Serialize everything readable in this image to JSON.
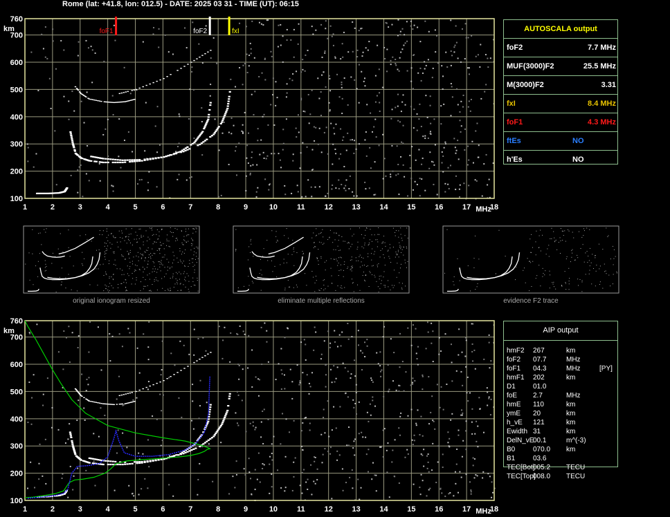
{
  "header": "Rome (lat: +41.8, lon: 012.5) - DATE: 2025 03 31 - TIME (UT): 06:15",
  "colors": {
    "grid": "#9a9a80",
    "frame": "#e6e6a0",
    "fof1": "#ff1a1a",
    "fxi": "#ffff00",
    "ftes": "#2a7fff",
    "profile": "#00d000",
    "aip_trace": "#2a2aff"
  },
  "autoscala": {
    "title": "AUTOSCALA output",
    "rows": [
      {
        "key": "foF2",
        "value": "7.7 MHz",
        "color": "#ffffff"
      },
      {
        "key": "MUF(3000)F2",
        "value": "25.5 MHz",
        "color": "#ffffff"
      },
      {
        "key": "M(3000)F2",
        "value": "3.31",
        "color": "#ffffff"
      },
      {
        "key": "fxI",
        "value": "8.4 MHz",
        "color": "#e6c200"
      },
      {
        "key": "foF1",
        "value": "4.3 MHz",
        "color": "#ff1a1a"
      },
      {
        "key": "ftEs",
        "value": "NO",
        "color": "#2a7fff"
      },
      {
        "key": "h'Es",
        "value": "NO",
        "color": "#ffffff"
      }
    ]
  },
  "aip": {
    "title": "AIP output",
    "rows": [
      [
        "hmF2",
        "267",
        "km",
        ""
      ],
      [
        "foF2",
        "07.7",
        "MHz",
        ""
      ],
      [
        "foF1",
        "04.3",
        "MHz",
        "[PY]"
      ],
      [
        "hmF1",
        "202",
        "km",
        ""
      ],
      [
        "D1",
        "01.0",
        "",
        ""
      ],
      [
        "foE",
        "2.7",
        "MHz",
        ""
      ],
      [
        "hmE",
        "110",
        "km",
        ""
      ],
      [
        "ymE",
        "20",
        "km",
        ""
      ],
      [
        "h_vE",
        "121",
        "km",
        ""
      ],
      [
        "Ewidth",
        "31",
        "km",
        ""
      ],
      [
        "DelN_vE",
        "00.1",
        "m^(-3)",
        ""
      ],
      [
        "B0",
        "070.0",
        "km",
        ""
      ],
      [
        "B1",
        "03.6",
        "",
        ""
      ],
      [
        "TEC[Bot]",
        "005.2",
        "TECU",
        ""
      ],
      [
        "TEC[Top]",
        "008.0",
        "TECU",
        ""
      ]
    ]
  },
  "thumbnails": [
    {
      "label": "original ionogram resized"
    },
    {
      "label": "eliminate multiple reflections"
    },
    {
      "label": "evidence F2 trace"
    }
  ],
  "chart_data": [
    {
      "type": "scatter",
      "title": "",
      "xlabel": "MHz",
      "ylabel": "km",
      "xlim": [
        1,
        18
      ],
      "ylim": [
        100,
        760
      ],
      "x_ticks": [
        1,
        2,
        3,
        4,
        5,
        6,
        7,
        8,
        9,
        10,
        11,
        12,
        13,
        14,
        15,
        16,
        17,
        18
      ],
      "y_ticks": [
        100,
        200,
        300,
        400,
        500,
        600,
        700,
        760
      ],
      "grid": true,
      "markers": [
        {
          "label": "foF1",
          "x": 4.3,
          "color": "#ff1a1a"
        },
        {
          "label": "foF2",
          "x": 7.7,
          "color": "#ffffff"
        },
        {
          "label": "fxI",
          "x": 8.4,
          "color": "#ffff00"
        }
      ],
      "traces": [
        {
          "x": [
            1.4,
            1.8,
            2.2,
            2.4,
            2.5
          ],
          "y": [
            118,
            118,
            120,
            125,
            140
          ]
        },
        {
          "x": [
            2.6,
            2.7,
            2.8,
            3.0,
            3.3,
            3.8,
            4.5,
            5.2,
            6.0,
            6.6,
            7.1,
            7.4,
            7.6,
            7.7
          ],
          "y": [
            350,
            300,
            265,
            248,
            238,
            232,
            232,
            238,
            252,
            272,
            305,
            345,
            390,
            460
          ]
        },
        {
          "x": [
            3.3,
            3.8,
            4.5,
            5.2,
            6.0,
            6.7,
            7.3,
            7.8,
            8.1,
            8.3,
            8.4
          ],
          "y": [
            255,
            246,
            240,
            242,
            252,
            272,
            298,
            335,
            380,
            430,
            500
          ]
        },
        {
          "x": [
            2.8,
            3.0,
            3.3,
            3.8,
            4.2,
            4.6,
            5.0
          ],
          "y": [
            510,
            485,
            465,
            455,
            452,
            455,
            465
          ]
        },
        {
          "x": [
            4.4,
            5.0,
            6.0,
            7.0,
            7.8
          ],
          "y": [
            485,
            500,
            540,
            600,
            650
          ]
        }
      ]
    },
    {
      "type": "scatter",
      "title": "",
      "xlabel": "MHz",
      "ylabel": "km",
      "xlim": [
        1,
        18
      ],
      "ylim": [
        100,
        760
      ],
      "x_ticks": [
        1,
        2,
        3,
        4,
        5,
        6,
        7,
        8,
        9,
        10,
        11,
        12,
        13,
        14,
        15,
        16,
        17,
        18
      ],
      "y_ticks": [
        100,
        200,
        300,
        400,
        500,
        600,
        700,
        760
      ],
      "grid": true,
      "traces": [
        {
          "x": [
            1.4,
            1.8,
            2.2,
            2.4,
            2.5
          ],
          "y": [
            112,
            114,
            118,
            124,
            140
          ]
        },
        {
          "x": [
            2.6,
            2.7,
            2.8,
            3.0,
            3.3,
            3.8,
            4.5,
            5.2,
            6.0,
            6.6,
            7.1,
            7.4,
            7.6,
            7.7
          ],
          "y": [
            350,
            300,
            265,
            248,
            238,
            232,
            232,
            238,
            252,
            272,
            305,
            345,
            390,
            460
          ]
        },
        {
          "x": [
            3.3,
            3.8,
            4.5,
            5.2,
            6.0,
            6.7,
            7.3,
            7.8,
            8.1,
            8.3,
            8.4
          ],
          "y": [
            255,
            246,
            240,
            242,
            252,
            272,
            298,
            335,
            380,
            430,
            500
          ]
        },
        {
          "x": [
            2.8,
            3.0,
            3.3,
            3.8,
            4.2,
            4.6,
            5.0
          ],
          "y": [
            510,
            485,
            465,
            455,
            452,
            455,
            465
          ]
        },
        {
          "x": [
            4.4,
            5.0,
            6.0,
            7.0,
            7.8
          ],
          "y": [
            485,
            500,
            540,
            600,
            650
          ]
        }
      ],
      "profile_curve": {
        "x": [
          1.0,
          1.3,
          1.7,
          2.1,
          2.4,
          2.5,
          2.6,
          2.8,
          3.1,
          3.5,
          3.9,
          4.1,
          4.3,
          4.7,
          5.3,
          6.0,
          6.6,
          7.0,
          7.3,
          7.5,
          7.6,
          7.7,
          7.6,
          7.3,
          6.8,
          6.0,
          5.0,
          4.0,
          3.2,
          2.7,
          2.3,
          2.0,
          1.7,
          1.4,
          1.1,
          1.0
        ],
        "y": [
          110,
          112,
          118,
          125,
          135,
          150,
          165,
          175,
          178,
          185,
          200,
          215,
          235,
          245,
          250,
          255,
          260,
          265,
          272,
          280,
          287,
          290,
          295,
          305,
          318,
          330,
          348,
          375,
          420,
          470,
          530,
          580,
          635,
          690,
          740,
          760
        ]
      },
      "aip_trace": {
        "x": [
          1.1,
          1.6,
          2.1,
          2.4,
          2.55,
          2.7,
          2.9,
          3.3,
          3.7,
          4.0,
          4.2,
          4.3,
          4.4,
          4.6,
          5.0,
          5.6,
          6.2,
          6.8,
          7.2,
          7.5,
          7.65,
          7.7
        ],
        "y": [
          108,
          112,
          118,
          126,
          140,
          200,
          225,
          228,
          236,
          260,
          320,
          355,
          320,
          275,
          262,
          262,
          268,
          285,
          310,
          350,
          420,
          555
        ]
      }
    }
  ]
}
